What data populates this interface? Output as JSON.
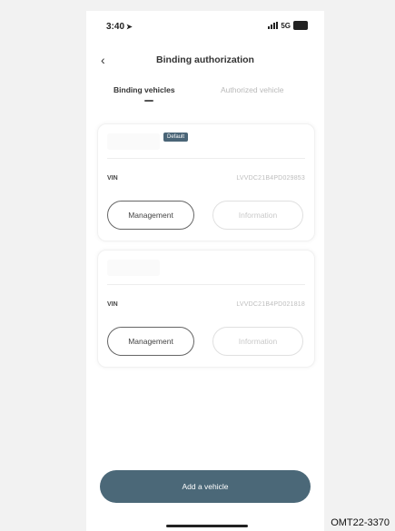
{
  "status_bar": {
    "time": "3:40",
    "network": "5G"
  },
  "nav": {
    "title": "Binding authorization"
  },
  "tabs": [
    {
      "label": "Binding vehicles",
      "active": true
    },
    {
      "label": "Authorized vehicle",
      "active": false
    }
  ],
  "vehicles": [
    {
      "badge": "Default",
      "vin_label": "VIN",
      "vin": "LVVDC21B4PD029853",
      "management_label": "Management",
      "info_label": "Information"
    },
    {
      "vin_label": "VIN",
      "vin": "LVVDC21B4PD021818",
      "management_label": "Management",
      "info_label": "Information"
    }
  ],
  "footer": {
    "add_button": "Add a vehicle"
  },
  "figure_code": "OMT22-3370",
  "colors": {
    "primary": "#4b6878",
    "badge": "#4a6577"
  }
}
